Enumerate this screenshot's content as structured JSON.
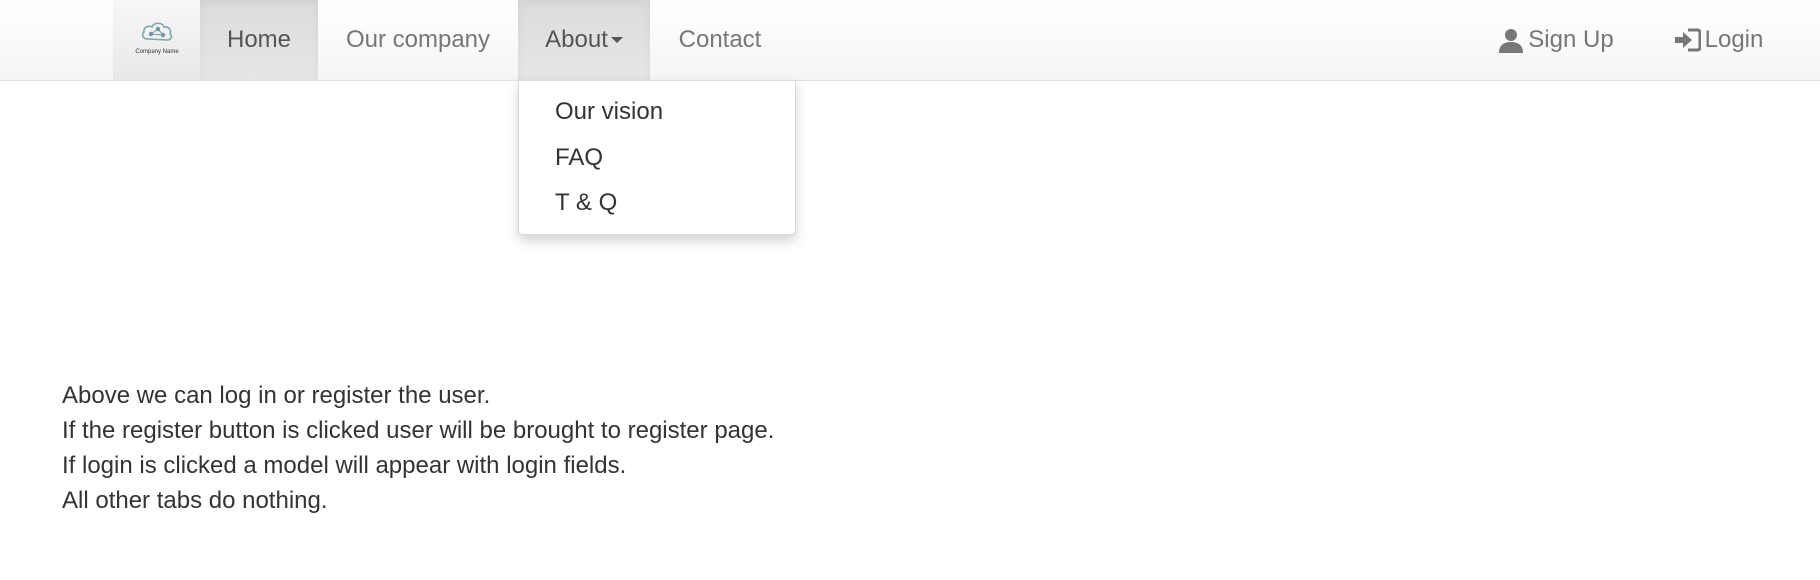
{
  "navbar": {
    "brand": {
      "logo_text": "Company Name",
      "icon": "cloud-logo-icon"
    },
    "items": [
      {
        "label": "Home",
        "active": true
      },
      {
        "label": "Our company",
        "active": false
      },
      {
        "label": "About",
        "active": false,
        "dropdown": true
      },
      {
        "label": "Contact",
        "active": false
      }
    ],
    "right": [
      {
        "label": "Sign Up",
        "icon": "user-icon"
      },
      {
        "label": "Login",
        "icon": "login-icon"
      }
    ]
  },
  "about_dropdown": {
    "items": [
      "Our vision",
      "FAQ",
      "T & Q"
    ]
  },
  "content": {
    "lines": [
      "Above we can log in or register the user.",
      "If the register button is clicked user will be brought to register page.",
      "If login is clicked a model will appear with login fields.",
      "All other tabs do nothing."
    ]
  },
  "colors": {
    "nav_text": "#777777",
    "active_bg": "#e0e0e0",
    "body_text": "#333333"
  }
}
